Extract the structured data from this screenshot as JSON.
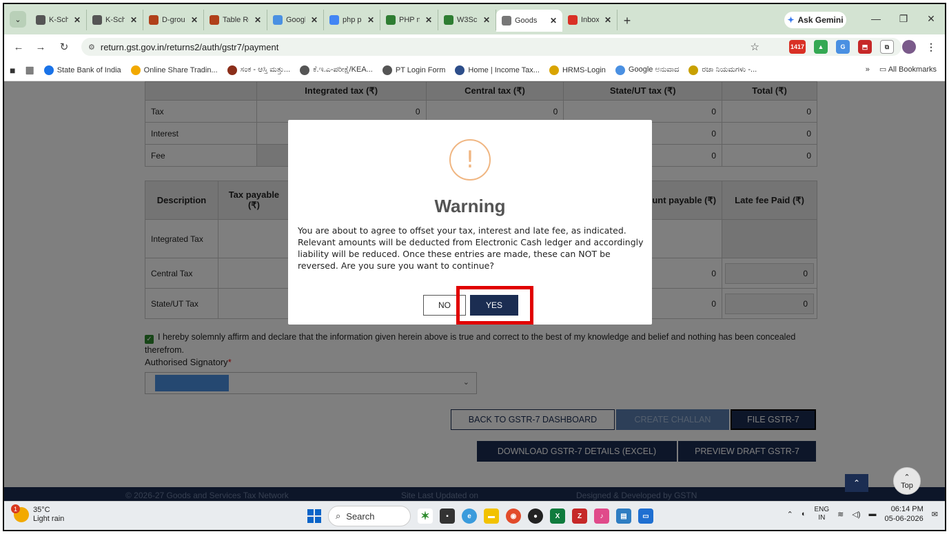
{
  "browser": {
    "tabs": [
      {
        "label": "K-Scho",
        "icon_color": "#555555"
      },
      {
        "label": "K-Scho",
        "icon_color": "#555555"
      },
      {
        "label": "D-group",
        "icon_color": "#b0401a"
      },
      {
        "label": "Table Ro",
        "icon_color": "#b0401a"
      },
      {
        "label": "Google",
        "icon_color": "#4a90e2"
      },
      {
        "label": "php prin",
        "icon_color": "#4285f4"
      },
      {
        "label": "PHP nun",
        "icon_color": "#2e7d32"
      },
      {
        "label": "W3Scho",
        "icon_color": "#2e7d32"
      },
      {
        "label": "Goods",
        "icon_color": "#777777",
        "active": true
      },
      {
        "label": "Inbox (1",
        "icon_color": "#d93025"
      }
    ],
    "ask_gemini": "Ask Gemini",
    "url": "return.gst.gov.in/returns2/auth/gstr7/payment",
    "calendar_badge": "1417",
    "bookmarks": [
      {
        "label": "State Bank of India",
        "color": "#1a73e8"
      },
      {
        "label": "Online Share Tradin...",
        "color": "#f2a900"
      },
      {
        "label": "ಸಂಕ - ಆಸ್ತಿ ಮತ್ತು...",
        "color": "#8b2e1a"
      },
      {
        "label": "ಕೆ.ಇ.ಎ-ಪರೀಕ್ಷೆ/KEA...",
        "color": "#555555"
      },
      {
        "label": "PT Login Form",
        "color": "#555555"
      },
      {
        "label": "Home | Income Tax...",
        "color": "#2d4e8a"
      },
      {
        "label": "HRMS-Login",
        "color": "#d9a400"
      },
      {
        "label": "Google ಅನುವಾದ",
        "color": "#4a90e2"
      },
      {
        "label": "ರಜಾ ನಿಯಮಗಳು -...",
        "color": "#c8a000"
      }
    ],
    "all_bookmarks": "All Bookmarks"
  },
  "tax_table": {
    "headers": [
      "",
      "Integrated tax (₹)",
      "Central tax (₹)",
      "State/UT tax (₹)",
      "Total (₹)"
    ],
    "rows": [
      {
        "label": "Tax",
        "values": [
          "0",
          "0",
          "0",
          "0"
        ]
      },
      {
        "label": "Interest",
        "values": [
          "",
          "",
          "0",
          "0"
        ]
      },
      {
        "label": "Fee",
        "values": [
          "",
          "",
          "0",
          "0"
        ]
      }
    ]
  },
  "payment_table": {
    "headers": [
      "Description",
      "Tax payable (₹)",
      "nount payable (₹)",
      "Late fee Paid (₹)"
    ],
    "rows": [
      {
        "label": "Integrated Tax",
        "amount": "",
        "late_fee": ""
      },
      {
        "label": "Central Tax",
        "amount": "0",
        "late_fee": "0"
      },
      {
        "label": "State/UT Tax",
        "amount": "0",
        "late_fee": "0"
      }
    ]
  },
  "declaration": "I hereby solemnly affirm and declare that the information given herein above is true and correct to the best of my knowledge and belief and nothing has been concealed therefrom.",
  "signatory_label": "Authorised Signatory",
  "buttons": {
    "back": "BACK TO GSTR-7 DASHBOARD",
    "create_challan": "CREATE CHALLAN",
    "file": "FILE GSTR-7",
    "download": "DOWNLOAD GSTR-7 DETAILS (EXCEL)",
    "preview": "PREVIEW DRAFT GSTR-7",
    "top": "Top"
  },
  "footer": {
    "copyright": "© 2026-27 Goods and Services Tax Network",
    "updated": "Site Last Updated on",
    "designed": "Designed & Developed by GSTN"
  },
  "modal": {
    "title": "Warning",
    "message": "You are about to agree to offset your tax, interest and late fee, as indicated. Relevant amounts will be deducted from Electronic Cash ledger and accordingly liability will be reduced. Once these entries are made, these can NOT be reversed. Are you sure you want to continue?",
    "no": "NO",
    "yes": "YES"
  },
  "taskbar": {
    "temperature": "35°C",
    "weather": "Light rain",
    "weather_badge": "1",
    "search": "Search",
    "lang_top": "ENG",
    "lang_bottom": "IN",
    "time": "06:14 PM",
    "date": "05-06-2026"
  }
}
